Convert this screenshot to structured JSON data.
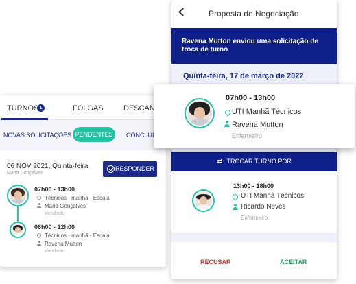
{
  "left": {
    "tabs": [
      {
        "label": "TURNOS",
        "badge": "1"
      },
      {
        "label": "FOLGAS"
      },
      {
        "label": "DESCANSO"
      }
    ],
    "subtabs": [
      "NOVAS SOLICITAÇÕES",
      "PENDENTES",
      "CONCLUÍDAS"
    ],
    "active_subtab": "PENDENTES",
    "date": "06 NOV 2021, Quinta-feira",
    "requester": "Maria Gonçalves",
    "respond_label": "RESPONDER",
    "shifts": [
      {
        "time": "07h00 - 13h00",
        "location": "Técnicos - manhã - Escala",
        "person": "Maria Gonçalves",
        "role": "Vendedor"
      },
      {
        "time": "06h00 - 12h00",
        "location": "Técnicos - manhã - Escala",
        "person": "Ravena Mutton",
        "role": "Vendedor"
      }
    ]
  },
  "right": {
    "title": "Proposta de Negociação",
    "banner": "Ravena Mutton enviou uma solicitação de troca de turno",
    "date": "Quinta-feira, 17 de março de 2022",
    "trade_label": "TROCAR TURNO POR",
    "offered_shift": {
      "time": "13h00 - 18h00",
      "location": "UTI Manhã Técnicos",
      "person": "Ricardo Neves",
      "role": "Enfermeiro"
    },
    "reject_label": "RECUSAR",
    "accept_label": "ACEITAR"
  },
  "overlay": {
    "time": "07h00 - 13h00",
    "location": "UTI Manhã Técnicos",
    "person": "Ravena Mutton",
    "role": "Enfermeiro"
  },
  "colors": {
    "primary": "#0f1f8a",
    "accent": "#23c4a3",
    "reject": "#c0392b",
    "accept": "#1e9e58"
  }
}
